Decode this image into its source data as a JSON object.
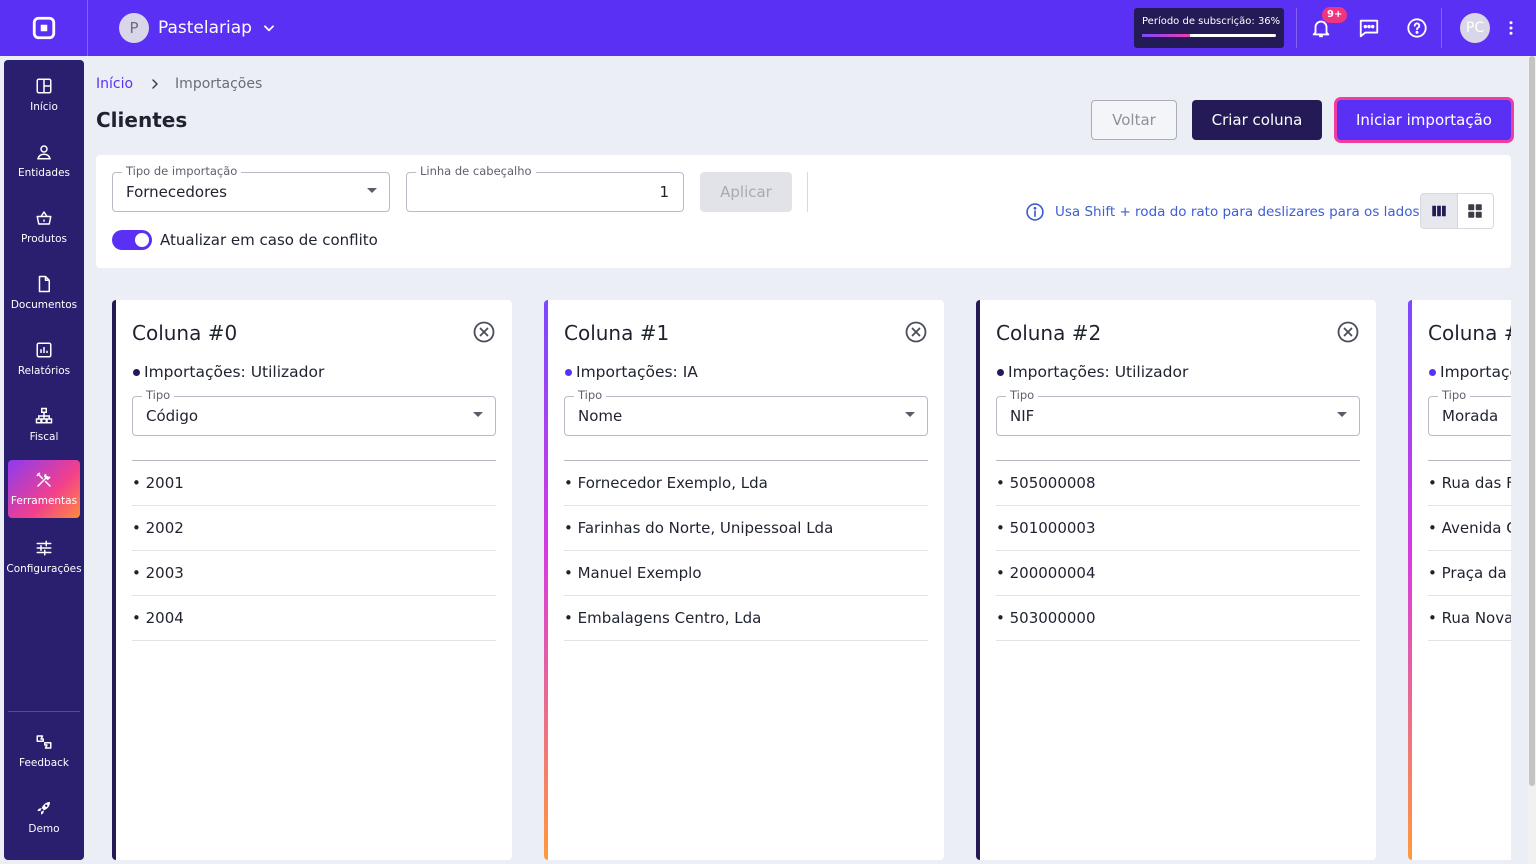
{
  "topbar": {
    "company_initial": "P",
    "company_name": "Pastelariap",
    "subscription_label": "Período de subscrição: 36%",
    "subscription_progress": 0.36,
    "notifications_badge": "9+",
    "user_initials": "PC"
  },
  "sidebar": {
    "items": [
      {
        "label": "Início",
        "icon": "grid-icon"
      },
      {
        "label": "Entidades",
        "icon": "person-icon"
      },
      {
        "label": "Produtos",
        "icon": "basket-icon"
      },
      {
        "label": "Documentos",
        "icon": "document-icon"
      },
      {
        "label": "Relatórios",
        "icon": "chart-icon"
      },
      {
        "label": "Fiscal",
        "icon": "hierarchy-icon"
      },
      {
        "label": "Ferramentas",
        "icon": "tools-icon",
        "active": true
      },
      {
        "label": "Configurações",
        "icon": "sliders-icon"
      }
    ],
    "bottom_items": [
      {
        "label": "Feedback",
        "icon": "feedback-icon"
      },
      {
        "label": "Demo",
        "icon": "rocket-icon"
      }
    ]
  },
  "breadcrumb": {
    "home": "Início",
    "current": "Importações"
  },
  "page": {
    "title": "Clientes"
  },
  "actions": {
    "back": "Voltar",
    "create_column": "Criar coluna",
    "start_import": "Iniciar importação"
  },
  "filters": {
    "import_type_label": "Tipo de importação",
    "import_type_value": "Fornecedores",
    "header_line_label": "Linha de cabeçalho",
    "header_line_value": "1",
    "apply": "Aplicar",
    "conflict_toggle_label": "Atualizar em caso de conflito",
    "conflict_toggle_on": true,
    "scroll_hint": "Usa Shift + roda do rato para deslizares para os lados",
    "view_mode": "columns"
  },
  "columns": [
    {
      "title": "Coluna #0",
      "import_source": "Importações: Utilizador",
      "source_kind": "user",
      "type_label": "Tipo",
      "type_value": "Código",
      "rows": [
        "• 2001",
        "• 2002",
        "• 2003",
        "• 2004"
      ]
    },
    {
      "title": "Coluna #1",
      "import_source": "Importações: IA",
      "source_kind": "ai",
      "type_label": "Tipo",
      "type_value": "Nome",
      "rows": [
        "• Fornecedor Exemplo, Lda",
        "• Farinhas do Norte, Unipessoal Lda",
        "• Manuel Exemplo",
        "• Embalagens Centro, Lda"
      ]
    },
    {
      "title": "Coluna #2",
      "import_source": "Importações: Utilizador",
      "source_kind": "user",
      "type_label": "Tipo",
      "type_value": "NIF",
      "rows": [
        "• 505000008",
        "• 501000003",
        "• 200000004",
        "• 503000000"
      ]
    },
    {
      "title": "Coluna #",
      "import_source": "Importaçõ",
      "source_kind": "ai",
      "type_label": "Tipo",
      "type_value": "Morada",
      "rows": [
        "• Rua das F",
        "• Avenida C",
        "• Praça da I",
        "• Rua Nova"
      ]
    }
  ],
  "colors": {
    "brand": "#5b30f5",
    "sidebar": "#2a1e6e",
    "dark_button": "#241a56",
    "highlight": "#f23ba0",
    "link": "#3d5ed6"
  }
}
